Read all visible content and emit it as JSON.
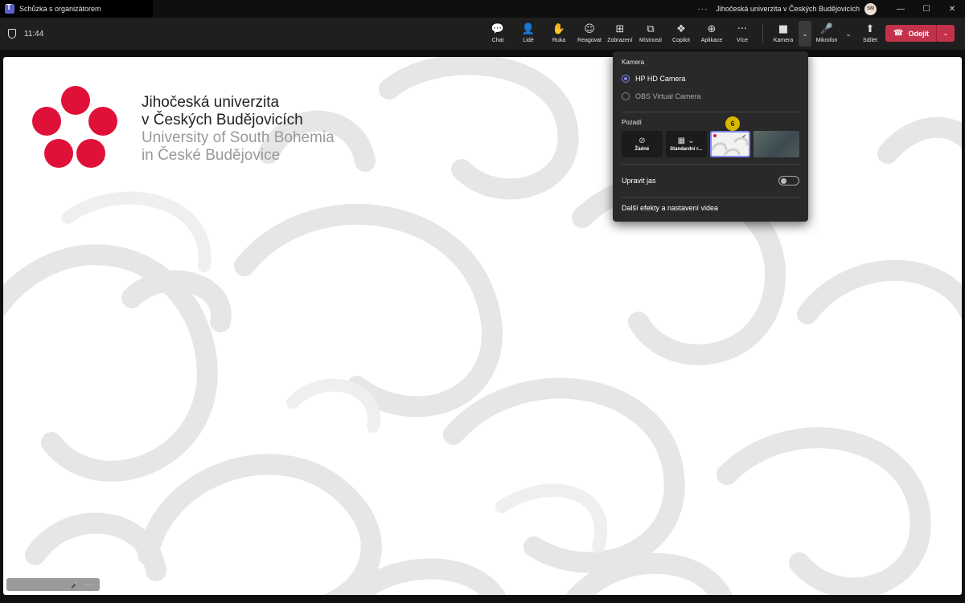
{
  "window": {
    "title": "Schůzka s organizátorem",
    "more": "···",
    "org": "Jihočeská univerzita v Českých Budějovicích",
    "avatar": "SM",
    "minimize": "—",
    "maximize": "☐",
    "close": "✕"
  },
  "meeting": {
    "time": "11:44"
  },
  "toolbar": {
    "items": [
      {
        "label": "Chat",
        "icon": "💬"
      },
      {
        "label": "Lidé",
        "icon": "👤"
      },
      {
        "label": "Ruka",
        "icon": "✋"
      },
      {
        "label": "Reagovat",
        "icon": "☺"
      },
      {
        "label": "Zobrazení",
        "icon": "⊞"
      },
      {
        "label": "Místnosti",
        "icon": "⧉"
      },
      {
        "label": "Copilot",
        "icon": "❖"
      },
      {
        "label": "Aplikace",
        "icon": "⊕"
      },
      {
        "label": "Více",
        "icon": "···"
      }
    ],
    "camera": {
      "label": "Kamera",
      "icon": "■"
    },
    "mic": {
      "label": "Mikrofon",
      "icon": "🎤"
    },
    "share": {
      "label": "Sdílet",
      "icon": "⬆"
    },
    "caret": "⌄",
    "leave": {
      "label": "Odejít",
      "icon": "☎"
    }
  },
  "stage": {
    "logo": {
      "line1": "Jihočeská univerzita",
      "line2": "v Českých Budějovicích",
      "line3": "University of South Bohemia",
      "line4": "in České Budějovice"
    },
    "nameplate": {
      "mic_icon": "🎤",
      "more": "···"
    }
  },
  "camera_flyout": {
    "camera_heading": "Kamera",
    "cameras": [
      {
        "label": "HP HD Camera",
        "selected": true
      },
      {
        "label": "OBS Virtual Camera",
        "selected": false
      }
    ],
    "background_heading": "Pozadí",
    "backgrounds": [
      {
        "label": "Žádné",
        "icon": "⊘"
      },
      {
        "label": "Standardní r...",
        "icon": "▦ ⌄"
      }
    ],
    "selected_check": "✔",
    "step_badge": "6",
    "brightness_label": "Upravit jas",
    "brightness_on": false,
    "more_link": "Další efekty a nastavení videa"
  },
  "colors": {
    "accent": "#7f85f5",
    "leave": "#c4314b",
    "logo_red": "#e01138",
    "badge": "#d9b800"
  }
}
